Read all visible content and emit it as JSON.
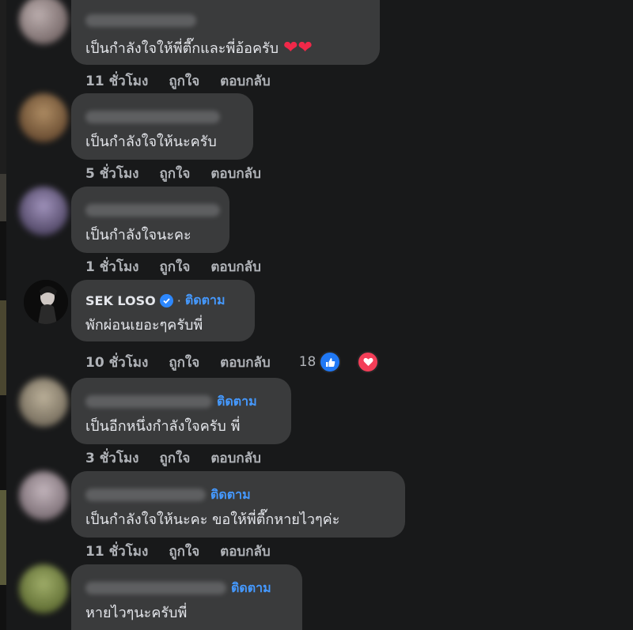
{
  "reactions": {
    "like_icon": "like-icon",
    "love_icon": "love-icon",
    "like_color": "#2078f4",
    "love_color": "#f33e58"
  },
  "accent_color": "#4599ff",
  "comments": [
    {
      "name": "",
      "follow": "",
      "text": "เป็นกำลังใจให้พี่ตี๊กและพี่อ้อครับ",
      "time": "11 ชั่วโมง",
      "like": "ถูกใจ",
      "reply": "ตอบกลับ",
      "reaction_count": ""
    },
    {
      "name": "",
      "follow": "",
      "text": "เป็นกำลังใจให้นะครับ",
      "time": "5 ชั่วโมง",
      "like": "ถูกใจ",
      "reply": "ตอบกลับ",
      "reaction_count": ""
    },
    {
      "name": "",
      "follow": "",
      "text": "เป็นกำลังใจนะคะ",
      "time": "1 ชั่วโมง",
      "like": "ถูกใจ",
      "reply": "ตอบกลับ",
      "reaction_count": ""
    },
    {
      "name": "SEK LOSO",
      "follow": "ติดตาม",
      "text": "พักผ่อนเยอะๆครับพี่",
      "time": "10 ชั่วโมง",
      "like": "ถูกใจ",
      "reply": "ตอบกลับ",
      "reaction_count": "18"
    },
    {
      "name": "",
      "follow": "ติดตาม",
      "text": "เป็นอีกหนึ่งกำลังใจครับ พี่",
      "time": "3 ชั่วโมง",
      "like": "ถูกใจ",
      "reply": "ตอบกลับ",
      "reaction_count": ""
    },
    {
      "name": "",
      "follow": "ติดตาม",
      "text": "เป็นกำลังใจให้นะคะ ขอให้พี่ตี๊กหายไวๆค่ะ",
      "time": "11 ชั่วโมง",
      "like": "ถูกใจ",
      "reply": "ตอบกลับ",
      "reaction_count": ""
    },
    {
      "name": "",
      "follow": "ติดตาม",
      "text": "หายไวๆนะครับพี่",
      "time": "",
      "like": "",
      "reply": "",
      "reaction_count": ""
    }
  ]
}
